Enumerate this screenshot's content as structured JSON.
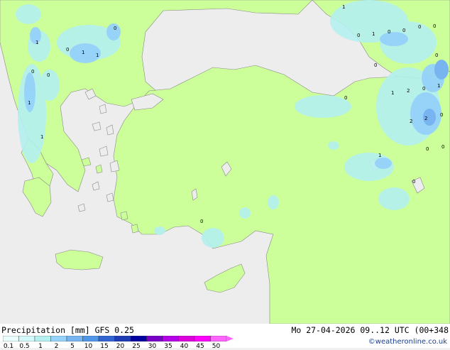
{
  "header": {
    "product": "Precipitation [mm]",
    "model": "GFS 0.25",
    "valid": "Mo 27-04-2026 09..12 UTC (00+348",
    "credit": "©weatheronline.co.uk"
  },
  "colors": {
    "sea": "#ededed",
    "land": "#ccff99",
    "precip_light": "#b4f0f0",
    "precip_medium": "#96d2fa",
    "precip_heavy": "#78b4f0",
    "coast": "#888888"
  },
  "legend": {
    "ticks": [
      "0.1",
      "0.5",
      "1",
      "2",
      "5",
      "10",
      "15",
      "20",
      "25",
      "30",
      "35",
      "40",
      "45",
      "50"
    ],
    "swatches": [
      "#eafefe",
      "#d2fafa",
      "#b4f0f0",
      "#96d2fa",
      "#78b4f0",
      "#5096e6",
      "#3264d2",
      "#1e3cb4",
      "#0000a0",
      "#7800c8",
      "#b400e6",
      "#dc00dc",
      "#ff00ff",
      "#ff64ff"
    ]
  },
  "map_values": [
    "1",
    "1",
    "0",
    "1",
    "1",
    "0",
    "0",
    "1",
    "1",
    "0",
    "1",
    "0",
    "0",
    "0",
    "0",
    "0",
    "0",
    "1",
    "2",
    "0",
    "1",
    "2",
    "2",
    "0",
    "0",
    "0",
    "1",
    "0",
    "0"
  ]
}
